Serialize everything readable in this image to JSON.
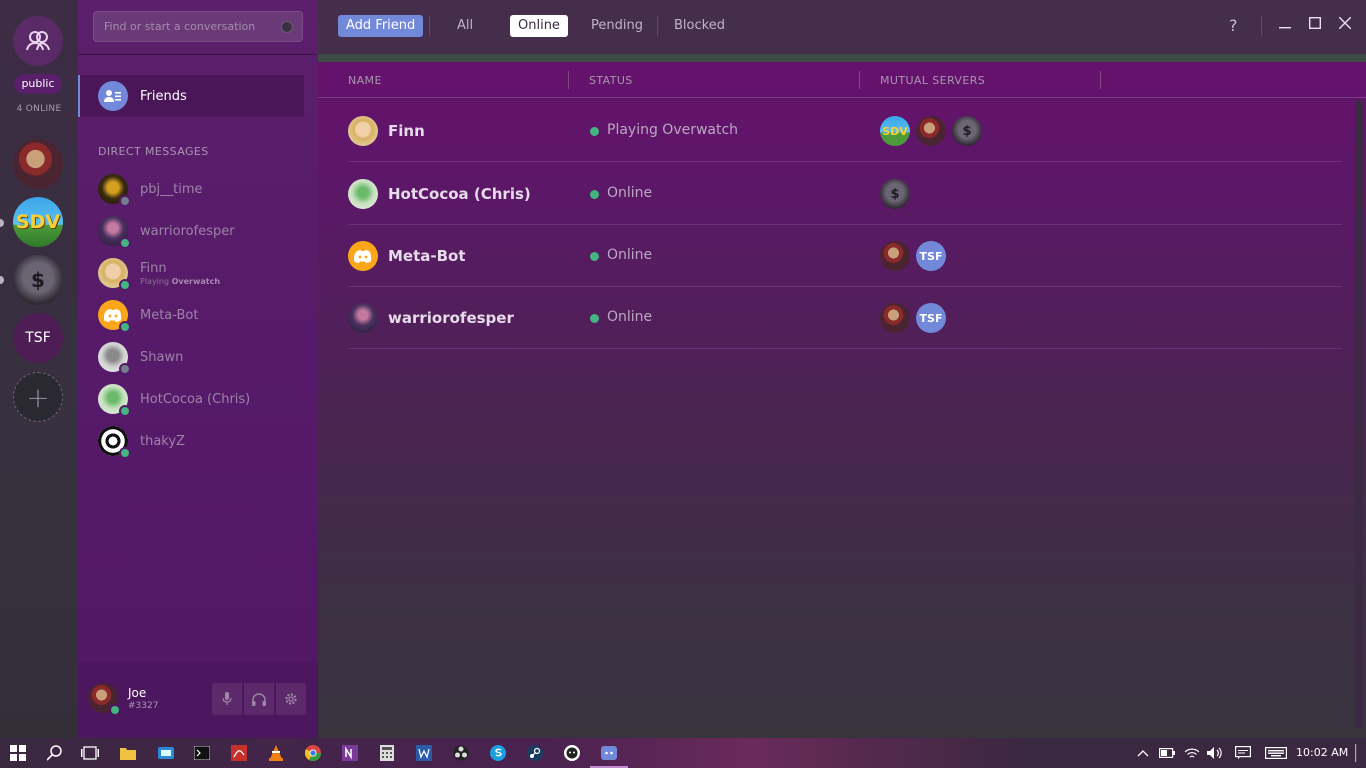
{
  "servers": {
    "public_label": "public",
    "online_label": "4 ONLINE",
    "sdv_text": "SDV",
    "money_text": "$",
    "tsf_label": "TSF",
    "add_symbol": "+"
  },
  "sidebar": {
    "search_placeholder": "Find or start a conversation",
    "friends_label": "Friends",
    "dm_heading": "DIRECT MESSAGES",
    "dms": [
      {
        "name": "pbj__time",
        "status": "offline",
        "status_color": "#747f8d"
      },
      {
        "name": "warriorofesper",
        "status": "online",
        "status_color": "#43b581"
      },
      {
        "name": "Finn",
        "status": "online",
        "status_color": "#43b581",
        "activity_prefix": "Playing",
        "activity": "Overwatch"
      },
      {
        "name": "Meta-Bot",
        "status": "online",
        "status_color": "#43b581"
      },
      {
        "name": "Shawn",
        "status": "offline",
        "status_color": "#747f8d"
      },
      {
        "name": "HotCocoa (Chris)",
        "status": "online",
        "status_color": "#43b581"
      },
      {
        "name": "thakyZ",
        "status": "online",
        "status_color": "#43b581"
      }
    ]
  },
  "user": {
    "name": "Joe",
    "tag": "#3327"
  },
  "topbar": {
    "add_friend": "Add Friend",
    "tabs": [
      "All",
      "Online",
      "Pending",
      "Blocked"
    ],
    "active_tab": "Online",
    "help": "?"
  },
  "table": {
    "columns": [
      "NAME",
      "STATUS",
      "MUTUAL SERVERS"
    ],
    "rows": [
      {
        "name": "Finn",
        "status": "Playing Overwatch",
        "mutual": [
          "SDV",
          "joe-server",
          "money-server"
        ]
      },
      {
        "name": "HotCocoa (Chris)",
        "status": "Online",
        "mutual": [
          "money-server"
        ]
      },
      {
        "name": "Meta-Bot",
        "status": "Online",
        "mutual": [
          "joe-server",
          "TSF"
        ]
      },
      {
        "name": "warriorofesper",
        "status": "Online",
        "mutual": [
          "joe-server",
          "TSF"
        ]
      }
    ]
  },
  "taskbar": {
    "clock": "10:02 AM"
  },
  "colors": {
    "accent": "#7289da",
    "online": "#43b581",
    "sidebar_bg": "#56196a"
  }
}
